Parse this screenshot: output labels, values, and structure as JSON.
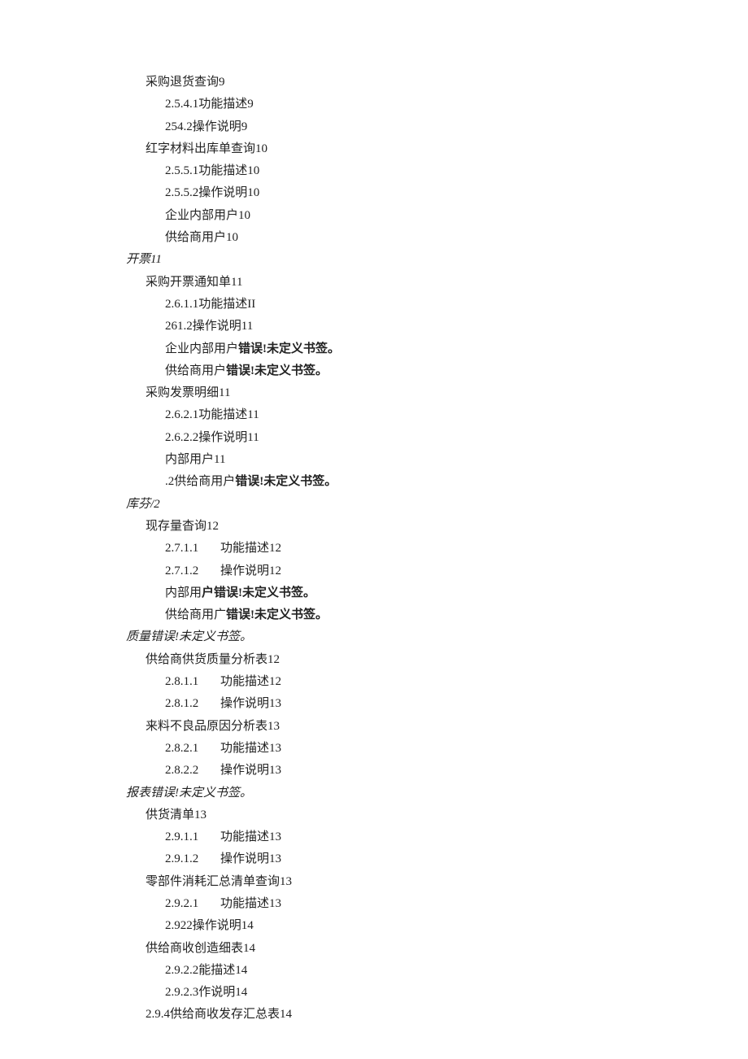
{
  "toc": [
    {
      "cls": "lvl-b",
      "text": "采购退货查询9"
    },
    {
      "cls": "lvl-c",
      "text": "2.5.4.1功能描述9"
    },
    {
      "cls": "lvl-c",
      "text": "254.2操作说明9"
    },
    {
      "cls": "lvl-b",
      "text": "红字材料出库单查询10"
    },
    {
      "cls": "lvl-c",
      "text": "2.5.5.1功能描述10"
    },
    {
      "cls": "lvl-c",
      "text": "2.5.5.2操作说明10"
    },
    {
      "cls": "lvl-c",
      "text": "企业内部用户10"
    },
    {
      "cls": "lvl-c",
      "text": "供给商用户10"
    },
    {
      "cls": "lvl-a",
      "text": "开票11"
    },
    {
      "cls": "lvl-b",
      "text": "采购开票通知单11"
    },
    {
      "cls": "lvl-c",
      "text": "2.6.1.1功能描述II"
    },
    {
      "cls": "lvl-c",
      "text": "261.2操作说明11"
    },
    {
      "cls": "lvl-c",
      "pre": "企业内部用户",
      "boldTail": "错误!未定义书签。"
    },
    {
      "cls": "lvl-c",
      "pre": "供给商用户",
      "boldTail": "错误!未定义书签。"
    },
    {
      "cls": "lvl-b",
      "text": "采购发票明细11"
    },
    {
      "cls": "lvl-c",
      "text": "2.6.2.1功能描述11"
    },
    {
      "cls": "lvl-c",
      "text": "2.6.2.2操作说明11"
    },
    {
      "cls": "lvl-c",
      "text": "内部用户11"
    },
    {
      "cls": "lvl-c",
      "pre": ".2供给商用户",
      "boldTail": "错误!未定义书签。"
    },
    {
      "cls": "lvl-a",
      "text": "库芬/2"
    },
    {
      "cls": "lvl-b",
      "text": "现存量杳询12"
    },
    {
      "cls": "lvl-c wide",
      "num": "2.7.1.1",
      "tail": "功能描述12"
    },
    {
      "cls": "lvl-c wide",
      "num": "2.7.1.2",
      "tail": "操作说明12"
    },
    {
      "cls": "lvl-c",
      "pre": "内部用",
      "boldPre": "户错误!未定义书签。"
    },
    {
      "cls": "lvl-c",
      "pre": "供给商用广",
      "boldPre": "错误!未定义书签。"
    },
    {
      "cls": "lvl-a",
      "text": "质量错误!未定义书签。"
    },
    {
      "cls": "lvl-b",
      "text": "供给商供货质量分析表12"
    },
    {
      "cls": "lvl-c wide",
      "num": "2.8.1.1",
      "tail": "功能描述12"
    },
    {
      "cls": "lvl-c wide",
      "num": "2.8.1.2",
      "tail": "操作说明13"
    },
    {
      "cls": "lvl-b",
      "text": "来料不良品原因分析表13"
    },
    {
      "cls": "lvl-c wide",
      "num": "2.8.2.1",
      "tail": "功能描述13"
    },
    {
      "cls": "lvl-c wide",
      "num": "2.8.2.2",
      "tail": "操作说明13"
    },
    {
      "cls": "lvl-a",
      "text": "报表错误!未定义书签。"
    },
    {
      "cls": "lvl-b",
      "text": "供货清单13"
    },
    {
      "cls": "lvl-c wide",
      "num": "2.9.1.1",
      "tail": "功能描述13"
    },
    {
      "cls": "lvl-c wide",
      "num": "2.9.1.2",
      "tail": "操作说明13"
    },
    {
      "cls": "lvl-b",
      "text": "零部件消耗汇总清单查询13"
    },
    {
      "cls": "lvl-c wide",
      "num": "2.9.2.1",
      "tail": "功能描述13"
    },
    {
      "cls": "lvl-c",
      "text": "2.922操作说明14"
    },
    {
      "cls": "lvl-b",
      "text": "供给商收创造细表14"
    },
    {
      "cls": "lvl-c wide2",
      "num": "2.9.2.2",
      "tail": "能描述14"
    },
    {
      "cls": "lvl-c wide2",
      "num": "2.9.2.3",
      "tail": "作说明14"
    },
    {
      "cls": "lvl-b",
      "text": "2.9.4供给商收发存汇总表14"
    }
  ]
}
